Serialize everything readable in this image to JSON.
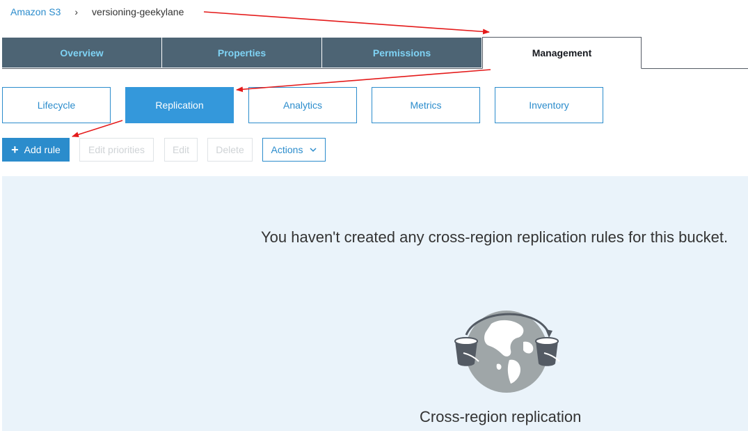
{
  "breadcrumb": {
    "root": "Amazon S3",
    "separator": "›",
    "current": "versioning-geekylane"
  },
  "main_tabs": [
    {
      "label": "Overview",
      "active": false
    },
    {
      "label": "Properties",
      "active": false
    },
    {
      "label": "Permissions",
      "active": false
    },
    {
      "label": "Management",
      "active": true
    }
  ],
  "sub_tabs": [
    {
      "label": "Lifecycle",
      "active": false
    },
    {
      "label": "Replication",
      "active": true
    },
    {
      "label": "Analytics",
      "active": false
    },
    {
      "label": "Metrics",
      "active": false
    },
    {
      "label": "Inventory",
      "active": false
    }
  ],
  "toolbar": {
    "add_rule_label": "Add rule",
    "edit_priorities_label": "Edit priorities",
    "edit_label": "Edit",
    "delete_label": "Delete",
    "actions_label": "Actions"
  },
  "empty_state": {
    "message": "You haven't created any cross-region replication rules for this bucket.",
    "feature_title": "Cross-region replication",
    "icon": "cross-region-replication-icon"
  },
  "colors": {
    "accent": "#2b8ccc",
    "active_subtab": "#3498db",
    "tab_bar": "#4d6474",
    "tab_text": "#7fd3f5",
    "panel_bg": "#eaf3fa",
    "annotation": "#e41a1a"
  }
}
